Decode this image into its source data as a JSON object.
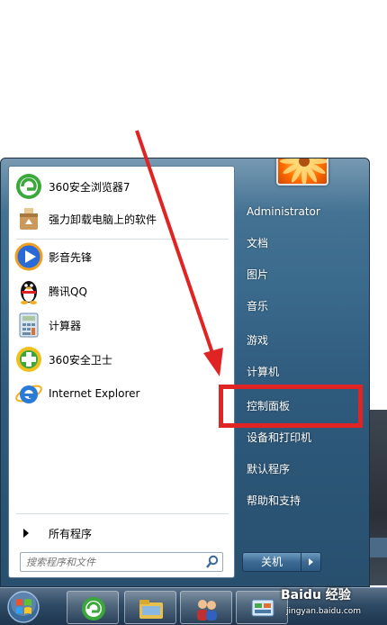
{
  "programs": [
    {
      "label": "360安全浏览器7",
      "icon": "360-browser-icon"
    },
    {
      "label": "强力卸载电脑上的软件",
      "icon": "uninstall-icon"
    },
    {
      "label": "影音先锋",
      "icon": "media-player-icon"
    },
    {
      "label": "腾讯QQ",
      "icon": "qq-penguin-icon"
    },
    {
      "label": "计算器",
      "icon": "calculator-icon"
    },
    {
      "label": "360安全卫士",
      "icon": "360-guard-icon"
    },
    {
      "label": "Internet Explorer",
      "icon": "ie-icon"
    }
  ],
  "all_programs": "所有程序",
  "search": {
    "placeholder": "搜索程序和文件"
  },
  "right_items": [
    "Administrator",
    "文档",
    "图片",
    "音乐",
    "游戏",
    "计算机",
    "控制面板",
    "设备和打印机",
    "默认程序",
    "帮助和支持"
  ],
  "shutdown_label": "关机",
  "watermark": "Baidu 经验",
  "watermark_sub": "jingyan.baidu.com",
  "colors": {
    "highlight": "#e02424",
    "menu": "#3a6a8c"
  }
}
